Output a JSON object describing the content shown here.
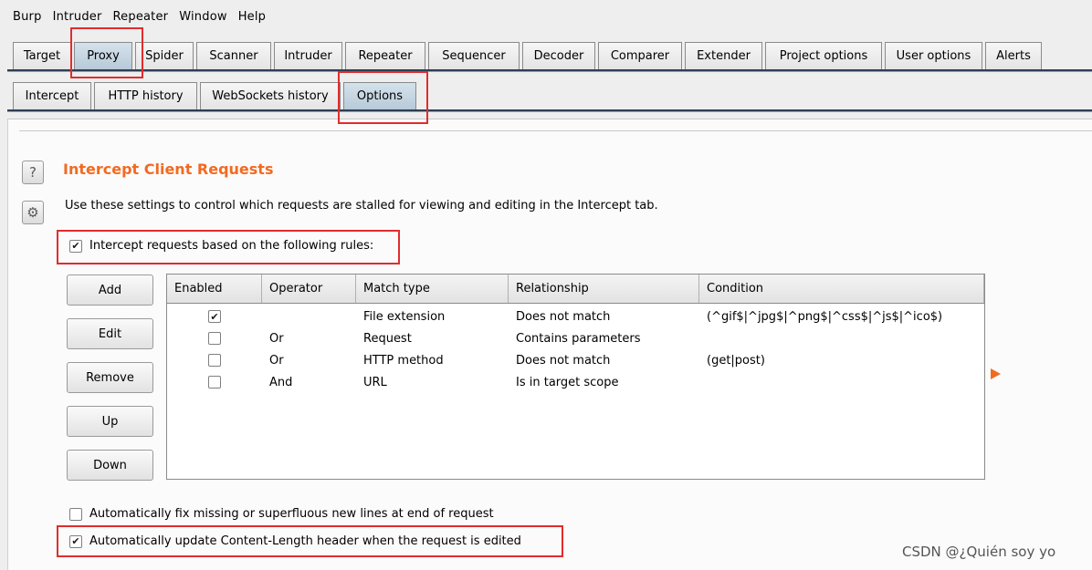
{
  "menubar": {
    "items": [
      "Burp",
      "Intruder",
      "Repeater",
      "Window",
      "Help"
    ]
  },
  "main_tabs": [
    "Target",
    "Proxy",
    "Spider",
    "Scanner",
    "Intruder",
    "Repeater",
    "Sequencer",
    "Decoder",
    "Comparer",
    "Extender",
    "Project options",
    "User options",
    "Alerts"
  ],
  "main_selected": "Proxy",
  "sub_tabs": [
    "Intercept",
    "HTTP history",
    "WebSockets history",
    "Options"
  ],
  "sub_selected": "Options",
  "section": {
    "title": "Intercept Client Requests",
    "description": "Use these settings to control which requests are stalled for viewing and editing in the Intercept tab.",
    "help_icon_glyph": "?",
    "settings_icon_glyph": "⚙",
    "intercept_rules_label": "Intercept requests based on the following rules:",
    "intercept_rules_checked": true
  },
  "buttons": {
    "add": "Add",
    "edit": "Edit",
    "remove": "Remove",
    "up": "Up",
    "down": "Down"
  },
  "table": {
    "columns": [
      "Enabled",
      "Operator",
      "Match type",
      "Relationship",
      "Condition"
    ],
    "rows": [
      {
        "enabled": true,
        "operator": "",
        "match_type": "File extension",
        "relationship": "Does not match",
        "condition": "(^gif$|^jpg$|^png$|^css$|^js$|^ico$)"
      },
      {
        "enabled": false,
        "operator": "Or",
        "match_type": "Request",
        "relationship": "Contains parameters",
        "condition": ""
      },
      {
        "enabled": false,
        "operator": "Or",
        "match_type": "HTTP method",
        "relationship": "Does not match",
        "condition": "(get|post)"
      },
      {
        "enabled": false,
        "operator": "And",
        "match_type": "URL",
        "relationship": "Is in target scope",
        "condition": ""
      }
    ]
  },
  "options": [
    {
      "label": "Automatically fix missing or superfluous new lines at end of request",
      "checked": false
    },
    {
      "label": "Automatically update Content-Length header when the request is edited",
      "checked": true
    }
  ],
  "watermark": "CSDN @¿Quién soy yo",
  "colors": {
    "accent_orange": "#f26a21",
    "highlight_red": "#e02d2d",
    "selected_tab": "#c5d5e2"
  }
}
